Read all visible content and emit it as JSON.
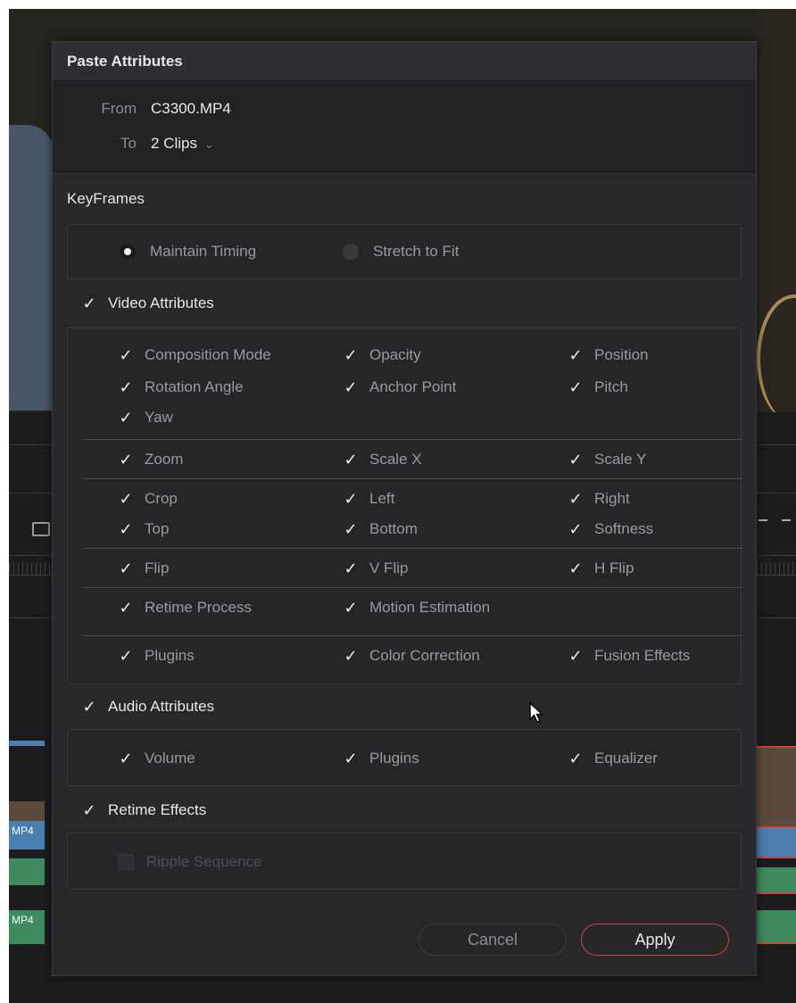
{
  "dialog": {
    "title": "Paste Attributes",
    "from_label": "From",
    "from_value": "C3300.MP4",
    "to_label": "To",
    "to_value": "2 Clips"
  },
  "keyframes": {
    "label": "KeyFrames",
    "options": [
      {
        "label": "Maintain Timing",
        "selected": true
      },
      {
        "label": "Stretch to Fit",
        "selected": false
      }
    ]
  },
  "video": {
    "label": "Video Attributes",
    "checked": true,
    "groups": [
      [
        "Composition Mode",
        "Opacity",
        "Position",
        "Rotation Angle",
        "Anchor Point",
        "Pitch",
        "Yaw"
      ],
      [
        "Zoom",
        "Scale X",
        "Scale Y"
      ],
      [
        "Crop",
        "Left",
        "Right",
        "Top",
        "Bottom",
        "Softness"
      ],
      [
        "Flip",
        "V Flip",
        "H Flip"
      ],
      [
        "Retime Process",
        "Motion Estimation"
      ],
      [
        "Plugins",
        "Color Correction",
        "Fusion Effects"
      ]
    ]
  },
  "audio": {
    "label": "Audio Attributes",
    "checked": true,
    "items": [
      "Volume",
      "Plugins",
      "Equalizer"
    ]
  },
  "retime": {
    "label": "Retime Effects",
    "checked": true,
    "items": [
      "Ripple Sequence"
    ]
  },
  "buttons": {
    "cancel": "Cancel",
    "apply": "Apply"
  },
  "background": {
    "clip_label": "MP4"
  },
  "colors": {
    "accent_red": "#c94343",
    "dialog_bg": "#28282b",
    "clip_blue": "#4a7fb0",
    "clip_green": "#3f8a5e"
  },
  "icons": {
    "check": "checkmark-icon",
    "chevron": "chevron-down-icon",
    "cursor": "mouse-pointer-icon"
  }
}
